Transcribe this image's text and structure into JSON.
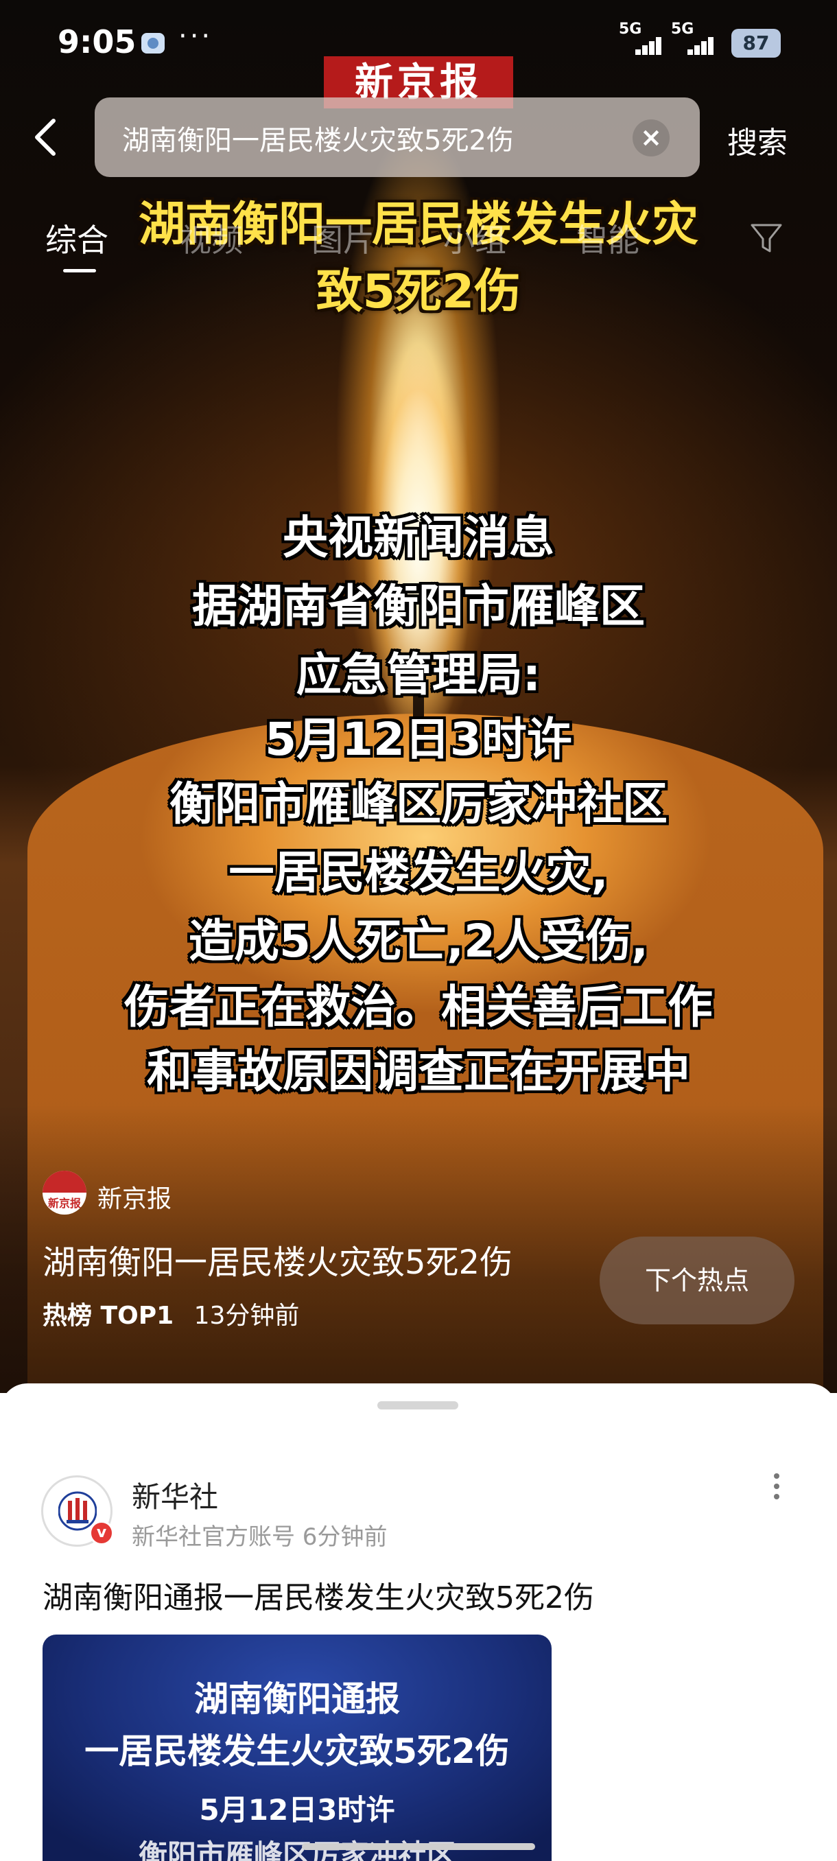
{
  "status_bar": {
    "time": "9:05",
    "dots": "···",
    "signal1": "5G",
    "signal2": "5G",
    "battery": "87"
  },
  "search": {
    "query": "湖南衡阳一居民楼火灾致5死2伤",
    "submit_label": "搜索"
  },
  "tabs": [
    {
      "label": "综合",
      "active": true
    },
    {
      "label": "视频",
      "active": false
    },
    {
      "label": "图片",
      "active": false
    },
    {
      "label": "小组",
      "active": false
    },
    {
      "label": "智能",
      "active": false
    }
  ],
  "hero": {
    "masthead": "新京报",
    "headline_lines": [
      "湖南衡阳一居民楼发生火灾",
      "致5死2伤"
    ],
    "body_lines": [
      "央视新闻消息",
      "据湖南省衡阳市雁峰区",
      "应急管理局:",
      "5月12日3时许",
      "衡阳市雁峰区厉家冲社区",
      "一居民楼发生火灾,",
      "造成5人死亡,2人受伤,",
      "伤者正在救治。相关善后工作",
      "和事故原因调查正在开展中"
    ],
    "source_name": "新京报",
    "source_logo_text": "新京报",
    "title": "湖南衡阳一居民楼火灾致5死2伤",
    "rank": "热榜 TOP1",
    "time_ago": "13分钟前",
    "next_label": "下个热点"
  },
  "post": {
    "author": "新华社",
    "sub": "新华社官方账号 6分钟前",
    "verified_mark": "v",
    "title": "湖南衡阳通报一居民楼发生火灾致5死2伤",
    "image_lines": [
      "湖南衡阳通报",
      "一居民楼发生火灾致5死2伤",
      "5月12日3时许",
      "衡阳市雁峰区厉家冲社区"
    ]
  },
  "colors": {
    "headline": "#ffe14a",
    "masthead_red": "#b51b1b",
    "post_image_blue": "#1a2f7a"
  }
}
